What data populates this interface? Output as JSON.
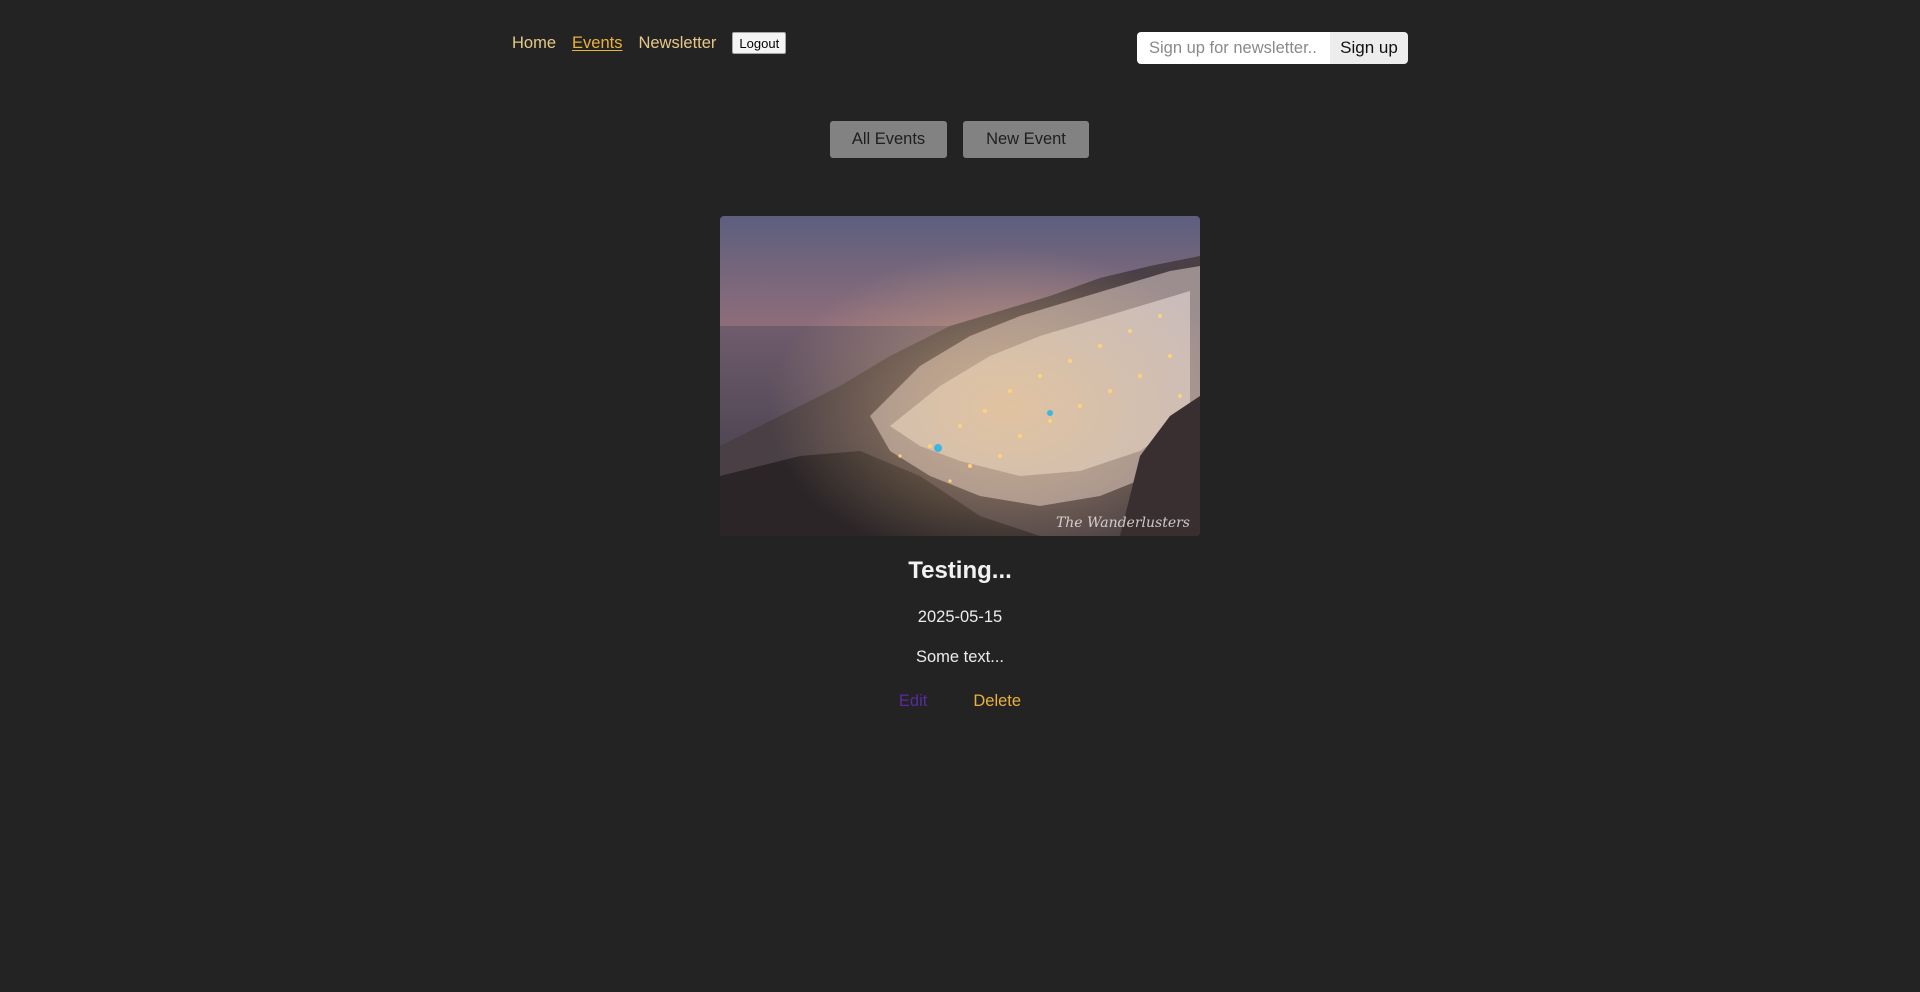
{
  "nav": {
    "home": "Home",
    "events": "Events",
    "newsletter": "Newsletter",
    "logout": "Logout"
  },
  "newsletter_form": {
    "placeholder": "Sign up for newsletter...",
    "button": "Sign up"
  },
  "events_nav": {
    "all_events": "All Events",
    "new_event": "New Event"
  },
  "event": {
    "title": "Testing...",
    "date": "2025-05-15",
    "description": "Some text...",
    "edit": "Edit",
    "delete": "Delete",
    "image_watermark": "The Wanderlusters"
  },
  "colors": {
    "background": "#232323",
    "nav_link": "#e7c886",
    "active_link": "#e8b23b",
    "edit_link": "#5a2a9c",
    "delete_link": "#e8b23b",
    "subnav_button": "#828282"
  }
}
